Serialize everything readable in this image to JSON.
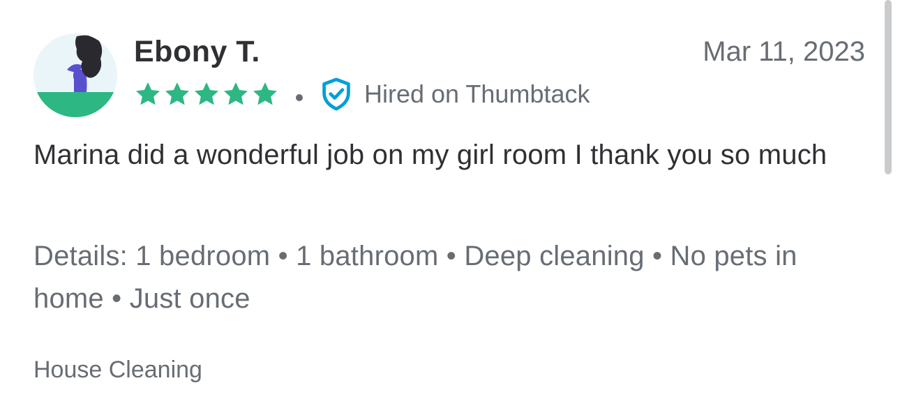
{
  "review": {
    "reviewer_name": "Ebony T.",
    "date": "Mar 11, 2023",
    "rating": 5,
    "rating_max": 5,
    "hired_badge": "Hired on Thumbtack",
    "text": "Marina did a wonderful job on my girl room I thank you so much",
    "details": "Details: 1 bedroom • 1 bathroom • Deep cleaning • No pets in home • Just once",
    "category": "House Cleaning"
  },
  "icons": {
    "avatar": "avatar-illustration",
    "star": "star-icon",
    "badge": "shield-check-icon"
  },
  "colors": {
    "star": "#2db783",
    "badge": "#009fd9",
    "avatar_bg": "#e9f5f9",
    "avatar_ground": "#2db783",
    "avatar_figure": "#5a4fcf",
    "avatar_hair": "#2a2a2e"
  }
}
